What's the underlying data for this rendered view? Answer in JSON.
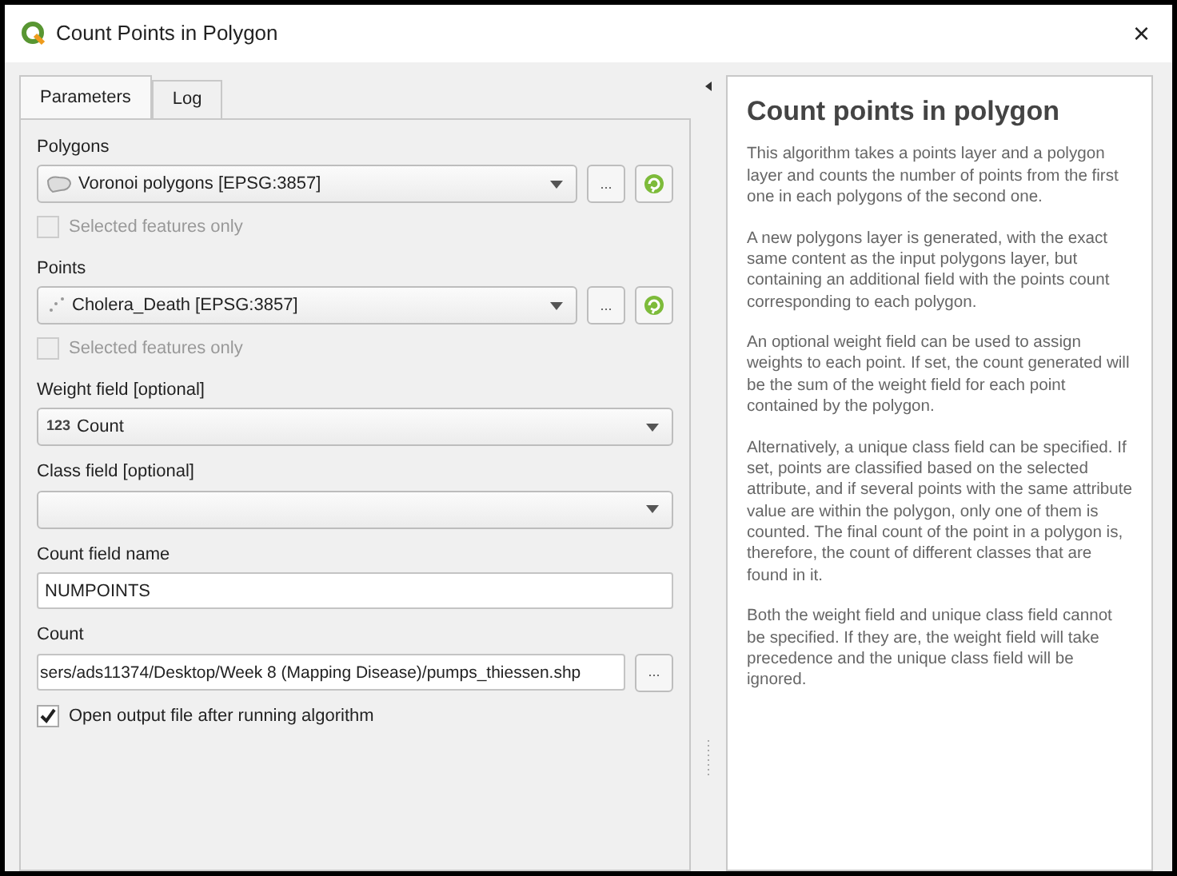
{
  "window": {
    "title": "Count Points in Polygon",
    "close": "×"
  },
  "tabs": [
    {
      "label": "Parameters",
      "selected": true
    },
    {
      "label": "Log",
      "selected": false
    }
  ],
  "parameters": [
    {
      "kind": "label",
      "text": "Polygons"
    },
    {
      "kind": "polygon_layer",
      "value": "Voronoi polygons [EPSG:3857]",
      "more": "..."
    },
    {
      "kind": "checkbox",
      "label": "Selected features only",
      "checked": false,
      "disabled": true
    },
    {
      "kind": "label",
      "text": "Points"
    },
    {
      "kind": "point_layer",
      "value": "Cholera_Death [EPSG:3857]",
      "more": "..."
    },
    {
      "kind": "checkbox",
      "label": "Selected features only",
      "checked": false,
      "disabled": true
    },
    {
      "kind": "label",
      "text": "Weight field [optional]"
    },
    {
      "kind": "field",
      "prefix": "123",
      "value": "Count"
    },
    {
      "kind": "label",
      "text": "Class field [optional]"
    },
    {
      "kind": "field"
    },
    {
      "kind": "label",
      "text": "Count field name"
    },
    {
      "kind": "text",
      "value": "NUMPOINTS"
    },
    {
      "kind": "label",
      "text": "Count"
    },
    {
      "kind": "file",
      "value": "sers/ads11374/Desktop/Week 8 (Mapping Disease)/pumps_thiessen.shp",
      "more": "..."
    },
    {
      "kind": "checkbox",
      "label": "Open output file after running algorithm",
      "checked": true,
      "disabled": false
    }
  ],
  "help": {
    "title": "Count points in polygon",
    "paragraphs": [
      "This algorithm takes a points layer and a polygon layer and counts the number of points from the first one in each polygons of the second one.",
      "A new polygons layer is generated, with the exact same content as the input polygons layer, but containing an additional field with the points count corresponding to each polygon.",
      "An optional weight field can be used to assign weights to each point. If set, the count generated will be the sum of the weight field for each point contained by the polygon.",
      "Alternatively, a unique class field can be specified. If set, points are classified based on the selected attribute, and if several points with the same attribute value are within the polygon, only one of them is counted. The final count of the point in a polygon is, therefore, the count of different classes that are found in it.",
      "Both the weight field and unique class field cannot be specified. If they are, the weight field will take precedence and the unique class field will be ignored."
    ]
  }
}
